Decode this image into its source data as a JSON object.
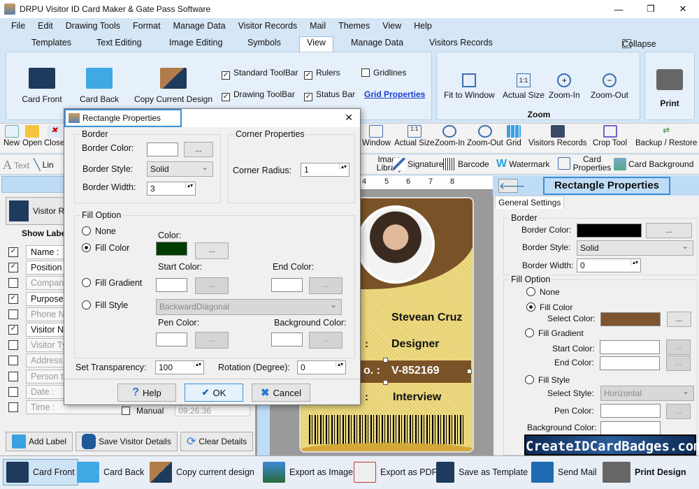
{
  "window": {
    "title": "DRPU Visitor ID Card Maker & Gate Pass Software",
    "min": "—",
    "max": "❐",
    "close": "✕"
  },
  "menu": [
    "File",
    "Edit",
    "Drawing Tools",
    "Format",
    "Manage Data",
    "Visitor Records",
    "Mail",
    "Themes",
    "View",
    "Help"
  ],
  "ribbon_tabs": [
    "Templates",
    "Text Editing",
    "Image Editing",
    "Symbols",
    "View",
    "Manage Data",
    "Visitors Records"
  ],
  "ribbon_active_tab": "View",
  "collapse": "Collapse",
  "ribbon": {
    "card_front": "Card Front",
    "card_back": "Card Back",
    "copy_design": "Copy Current Design",
    "options": [
      {
        "label": "Standard ToolBar",
        "checked": true
      },
      {
        "label": "Rulers",
        "checked": true
      },
      {
        "label": "Gridlines",
        "checked": false
      },
      {
        "label": "Drawing ToolBar",
        "checked": true
      },
      {
        "label": "Status Bar",
        "checked": true
      }
    ],
    "grid_properties": "Grid Properties",
    "fit": "Fit to Window",
    "actual": "Actual Size",
    "zoom_in": "Zoom-In",
    "zoom_out": "Zoom-Out",
    "zoom_group": "Zoom",
    "print": "Print"
  },
  "toolbar": [
    "New",
    "Open",
    "Close",
    "Window",
    "Actual Size",
    "Zoom-In",
    "Zoom-Out",
    "Grid",
    "Visitors Records",
    "Crop Tool",
    "Backup / Restore"
  ],
  "drawbar": {
    "text": "Text",
    "line": "Lin",
    "image_library": "Image Library",
    "signature": "Signature",
    "barcode": "Barcode",
    "watermark": "Watermark",
    "card_properties": "Card Properties",
    "card_background": "Card Background"
  },
  "left": {
    "visitor_tab": "Visitor R",
    "show_label": "Show Label",
    "labels": [
      {
        "text": "Name :",
        "checked": true
      },
      {
        "text": "Position :",
        "checked": true
      },
      {
        "text": "Company",
        "checked": false
      },
      {
        "text": "Purpose :",
        "checked": true
      },
      {
        "text": "Phone No",
        "checked": false
      },
      {
        "text": "Visitor No",
        "checked": true
      },
      {
        "text": "Visitor Ty",
        "checked": false
      },
      {
        "text": "Address :",
        "checked": false
      },
      {
        "text": "Person to",
        "checked": false
      },
      {
        "text": "Date :",
        "checked": false
      },
      {
        "text": "Time :",
        "checked": false
      }
    ],
    "manual": "Manual",
    "time_value": "09:26:36",
    "add_label": "Add Label",
    "save_details": "Save Visitor Details",
    "clear_details": "Clear Details"
  },
  "ruler": [
    "4",
    "5",
    "6",
    "7",
    "8"
  ],
  "card": {
    "name": "Stevean Cruz",
    "position": "Designer",
    "visitor_no_label": "o. :",
    "visitor_no": "V-852169",
    "purpose": "Interview",
    "sep": ":",
    "accent": "#7a5228",
    "bg": "#eedc8a"
  },
  "right": {
    "title": "Rectangle Properties",
    "tab": "General Settings",
    "border_group": "Border",
    "border_color_label": "Border Color:",
    "border_color": "#000000",
    "border_style_label": "Border Style:",
    "border_style": "Solid",
    "border_width_label": "Border Width:",
    "border_width": "0",
    "fill_group": "Fill Option",
    "none": "None",
    "fill_color": "Fill Color",
    "select_color": "Select Color:",
    "fill_color_value": "#7f5530",
    "fill_gradient": "Fill Gradient",
    "start_color": "Start Color:",
    "end_color": "End Color:",
    "fill_style": "Fill Style",
    "select_style": "Select Style:",
    "style_value": "Horizontal",
    "pen_color": "Pen Color:",
    "background_color": "Background Color:",
    "selected": "Fill Color",
    "dots": "..."
  },
  "watermark": "CreateIDCardBadges.com",
  "bottom": [
    "Card Front",
    "Card Back",
    "Copy current design",
    "Export as Image",
    "Export as PDF",
    "Save as Template",
    "Send Mail",
    "Print Design"
  ],
  "dialog": {
    "title": "Rectangle Properties",
    "close": "✕",
    "border": "Border",
    "border_color": "Border Color:",
    "border_style": "Border Style:",
    "border_style_value": "Solid",
    "border_width": "Border Width:",
    "border_width_value": "3",
    "corner": "Corner Properties",
    "corner_radius": "Corner Radius:",
    "corner_radius_value": "1",
    "fill_option": "Fill Option",
    "none": "None",
    "fill_color": "Fill Color",
    "fill_gradient": "Fill Gradient",
    "fill_style": "Fill Style",
    "color": "Color:",
    "color_value": "#003d00",
    "start_color": "Start Color:",
    "end_color": "End Color:",
    "style_value": "BackwardDiagonal",
    "pen_color": "Pen Color:",
    "background_color": "Background Color:",
    "transparency": "Set Transparency:",
    "transparency_value": "100",
    "rotation": "Rotation (Degree):",
    "rotation_value": "0",
    "help": "Help",
    "ok": "OK",
    "cancel": "Cancel",
    "dots": "...",
    "selected": "Fill Color"
  }
}
